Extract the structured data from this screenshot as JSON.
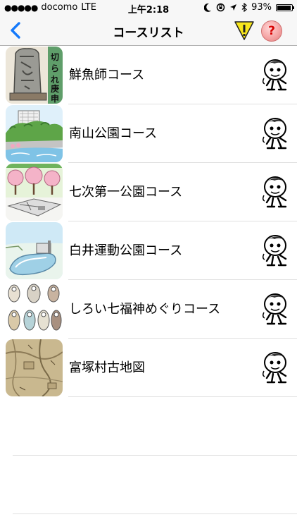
{
  "status": {
    "carrier": "docomo",
    "network": "LTE",
    "time": "上午2:18",
    "battery": "93%",
    "battery_level": 0.93
  },
  "nav": {
    "title": "コースリスト",
    "help_label": "?"
  },
  "thumb1_text": "切られ庚申",
  "courses": [
    {
      "label": "鮮魚師コース",
      "thumb": "stone-monument"
    },
    {
      "label": "南山公園コース",
      "thumb": "hill-park"
    },
    {
      "label": "七次第一公園コース",
      "thumb": "cherry-park"
    },
    {
      "label": "白井運動公園コース",
      "thumb": "sports-park"
    },
    {
      "label": "しろい七福神めぐりコース",
      "thumb": "seven-gods"
    },
    {
      "label": "富塚村古地図",
      "thumb": "old-map"
    }
  ]
}
